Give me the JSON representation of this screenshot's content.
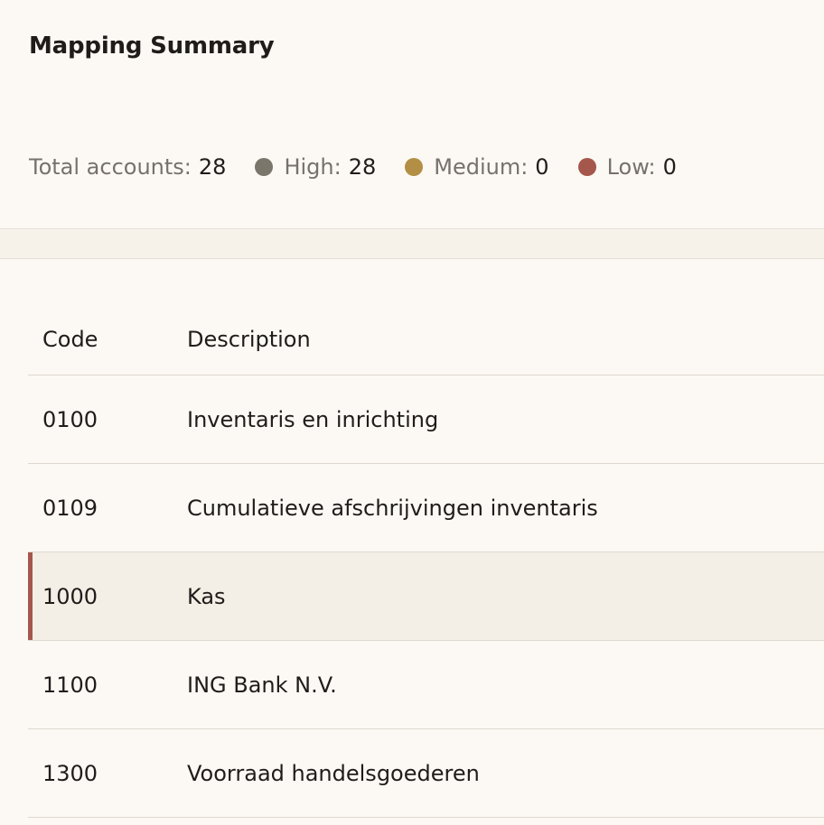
{
  "summary": {
    "title": "Mapping Summary",
    "total_label": "Total accounts:",
    "total_value": "28",
    "levels": [
      {
        "label": "High:",
        "value": "28",
        "color": "#7a766c"
      },
      {
        "label": "Medium:",
        "value": "0",
        "color": "#b38f45"
      },
      {
        "label": "Low:",
        "value": "0",
        "color": "#a5574b"
      }
    ]
  },
  "table": {
    "columns": {
      "code": "Code",
      "description": "Description"
    },
    "rows": [
      {
        "code": "0100",
        "description": "Inventaris en inrichting",
        "selected": false
      },
      {
        "code": "0109",
        "description": "Cumulatieve afschrijvingen inventaris",
        "selected": false
      },
      {
        "code": "1000",
        "description": "Kas",
        "selected": true
      },
      {
        "code": "1100",
        "description": "ING Bank N.V.",
        "selected": false
      },
      {
        "code": "1300",
        "description": "Voorraad handelsgoederen",
        "selected": false
      }
    ]
  }
}
